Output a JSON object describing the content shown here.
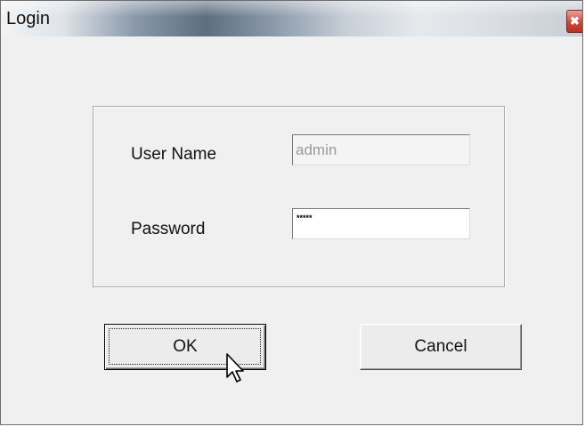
{
  "window": {
    "title": "Login"
  },
  "titlebar": {
    "close_glyph": "✖",
    "close_icon": "close-icon"
  },
  "form": {
    "username_label": "User Name",
    "username_value": "admin",
    "password_label": "Password",
    "password_value": "*****"
  },
  "buttons": {
    "ok_label": "OK",
    "cancel_label": "Cancel"
  },
  "cursor": {
    "icon": "arrow-pointer-icon"
  },
  "colors": {
    "dialog_background": "#f0f0f0",
    "close_button": "#c9473a"
  }
}
